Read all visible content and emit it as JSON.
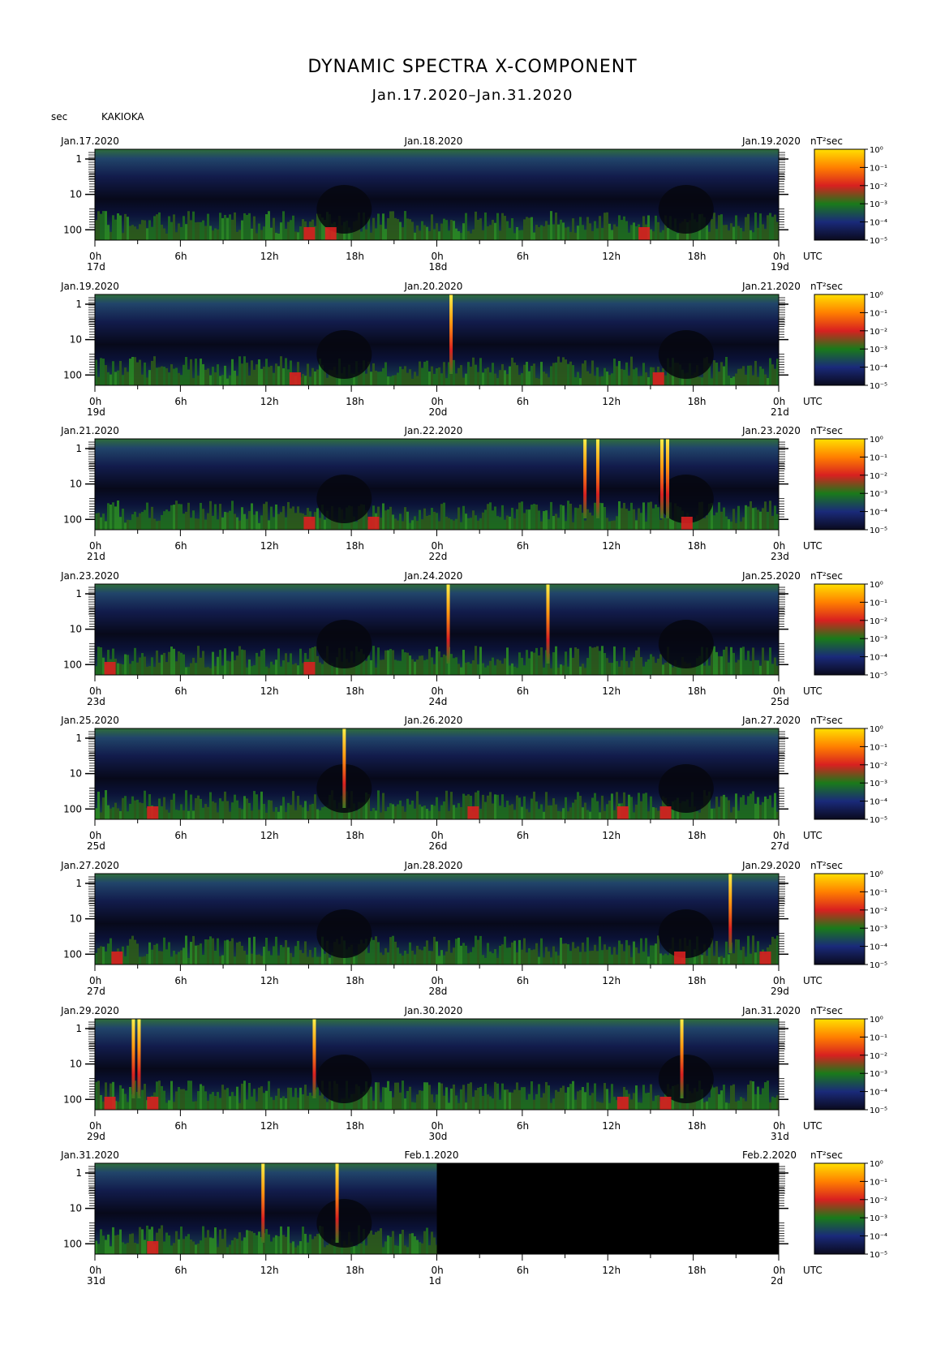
{
  "title": "DYNAMIC SPECTRA X-COMPONENT",
  "subtitle": "Jan.17.2020–Jan.31.2020",
  "units_label": "sec",
  "station": "KAKIOKA",
  "colorbar_unit": "nT²sec",
  "colorbar_ticks": [
    "10⁰",
    "10⁻¹",
    "10⁻²",
    "10⁻³",
    "10⁻⁴",
    "10⁻⁵"
  ],
  "colors": {
    "scale": [
      "#0a0a1e",
      "#1a2a7a",
      "#1a7a1a",
      "#d82020",
      "#ff8000",
      "#ffe000"
    ]
  },
  "chart_data": [
    {
      "type": "heatmap",
      "date_left": "Jan.17.2020",
      "date_mid": "Jan.18.2020",
      "date_right": "Jan.19.2020",
      "xticks": [
        "0h",
        "6h",
        "12h",
        "18h",
        "0h",
        "6h",
        "12h",
        "18h",
        "0h"
      ],
      "days": [
        "17d",
        "18d",
        "19d"
      ],
      "yticks": [
        "1",
        "10",
        "100"
      ],
      "x_unit": "UTC",
      "spikes": [],
      "red_bursts": [
        15.0,
        16.5,
        38.5
      ],
      "data_until_h": 48
    },
    {
      "type": "heatmap",
      "date_left": "Jan.19.2020",
      "date_mid": "Jan.20.2020",
      "date_right": "Jan.21.2020",
      "xticks": [
        "0h",
        "6h",
        "12h",
        "18h",
        "0h",
        "6h",
        "12h",
        "18h",
        "0h"
      ],
      "days": [
        "19d",
        "20d",
        "21d"
      ],
      "yticks": [
        "1",
        "10",
        "100"
      ],
      "x_unit": "UTC",
      "spikes": [
        25.0
      ],
      "red_bursts": [
        14.0,
        39.5
      ],
      "data_until_h": 48
    },
    {
      "type": "heatmap",
      "date_left": "Jan.21.2020",
      "date_mid": "Jan.22.2020",
      "date_right": "Jan.23.2020",
      "xticks": [
        "0h",
        "6h",
        "12h",
        "18h",
        "0h",
        "6h",
        "12h",
        "18h",
        "0h"
      ],
      "days": [
        "21d",
        "22d",
        "23d"
      ],
      "yticks": [
        "1",
        "10",
        "100"
      ],
      "x_unit": "UTC",
      "spikes": [
        34.4,
        35.3,
        39.8,
        40.2
      ],
      "red_bursts": [
        15.0,
        19.5,
        41.5
      ],
      "data_until_h": 48
    },
    {
      "type": "heatmap",
      "date_left": "Jan.23.2020",
      "date_mid": "Jan.24.2020",
      "date_right": "Jan.25.2020",
      "xticks": [
        "0h",
        "6h",
        "12h",
        "18h",
        "0h",
        "6h",
        "12h",
        "18h",
        "0h"
      ],
      "days": [
        "23d",
        "24d",
        "25d"
      ],
      "yticks": [
        "1",
        "10",
        "100"
      ],
      "x_unit": "UTC",
      "spikes": [
        24.8,
        31.8
      ],
      "red_bursts": [
        1.0,
        15.0
      ],
      "data_until_h": 48
    },
    {
      "type": "heatmap",
      "date_left": "Jan.25.2020",
      "date_mid": "Jan.26.2020",
      "date_right": "Jan.27.2020",
      "xticks": [
        "0h",
        "6h",
        "12h",
        "18h",
        "0h",
        "6h",
        "12h",
        "18h",
        "0h"
      ],
      "days": [
        "25d",
        "26d",
        "27d"
      ],
      "yticks": [
        "1",
        "10",
        "100"
      ],
      "x_unit": "UTC",
      "spikes": [
        17.5
      ],
      "red_bursts": [
        4.0,
        26.5,
        37.0,
        40.0
      ],
      "data_until_h": 48
    },
    {
      "type": "heatmap",
      "date_left": "Jan.27.2020",
      "date_mid": "Jan.28.2020",
      "date_right": "Jan.29.2020",
      "xticks": [
        "0h",
        "6h",
        "12h",
        "18h",
        "0h",
        "6h",
        "12h",
        "18h",
        "0h"
      ],
      "days": [
        "27d",
        "28d",
        "29d"
      ],
      "yticks": [
        "1",
        "10",
        "100"
      ],
      "x_unit": "UTC",
      "spikes": [
        44.6
      ],
      "red_bursts": [
        1.5,
        41.0,
        47.0
      ],
      "data_until_h": 48
    },
    {
      "type": "heatmap",
      "date_left": "Jan.29.2020",
      "date_mid": "Jan.30.2020",
      "date_right": "Jan.31.2020",
      "xticks": [
        "0h",
        "6h",
        "12h",
        "18h",
        "0h",
        "6h",
        "12h",
        "18h",
        "0h"
      ],
      "days": [
        "29d",
        "30d",
        "31d"
      ],
      "yticks": [
        "1",
        "10",
        "100"
      ],
      "x_unit": "UTC",
      "spikes": [
        2.7,
        3.1,
        15.4,
        41.2
      ],
      "red_bursts": [
        1.0,
        4.0,
        37.0,
        40.0
      ],
      "data_until_h": 48
    },
    {
      "type": "heatmap",
      "date_left": "Jan.31.2020",
      "date_mid": "Feb.1.2020",
      "date_right": "Feb.2.2020",
      "xticks": [
        "0h",
        "6h",
        "12h",
        "18h",
        "0h",
        "6h",
        "12h",
        "18h",
        "0h"
      ],
      "days": [
        "31d",
        "1d",
        "2d"
      ],
      "yticks": [
        "1",
        "10",
        "100"
      ],
      "x_unit": "UTC",
      "spikes": [
        11.8,
        17.0
      ],
      "red_bursts": [
        4.0
      ],
      "data_until_h": 24
    }
  ]
}
